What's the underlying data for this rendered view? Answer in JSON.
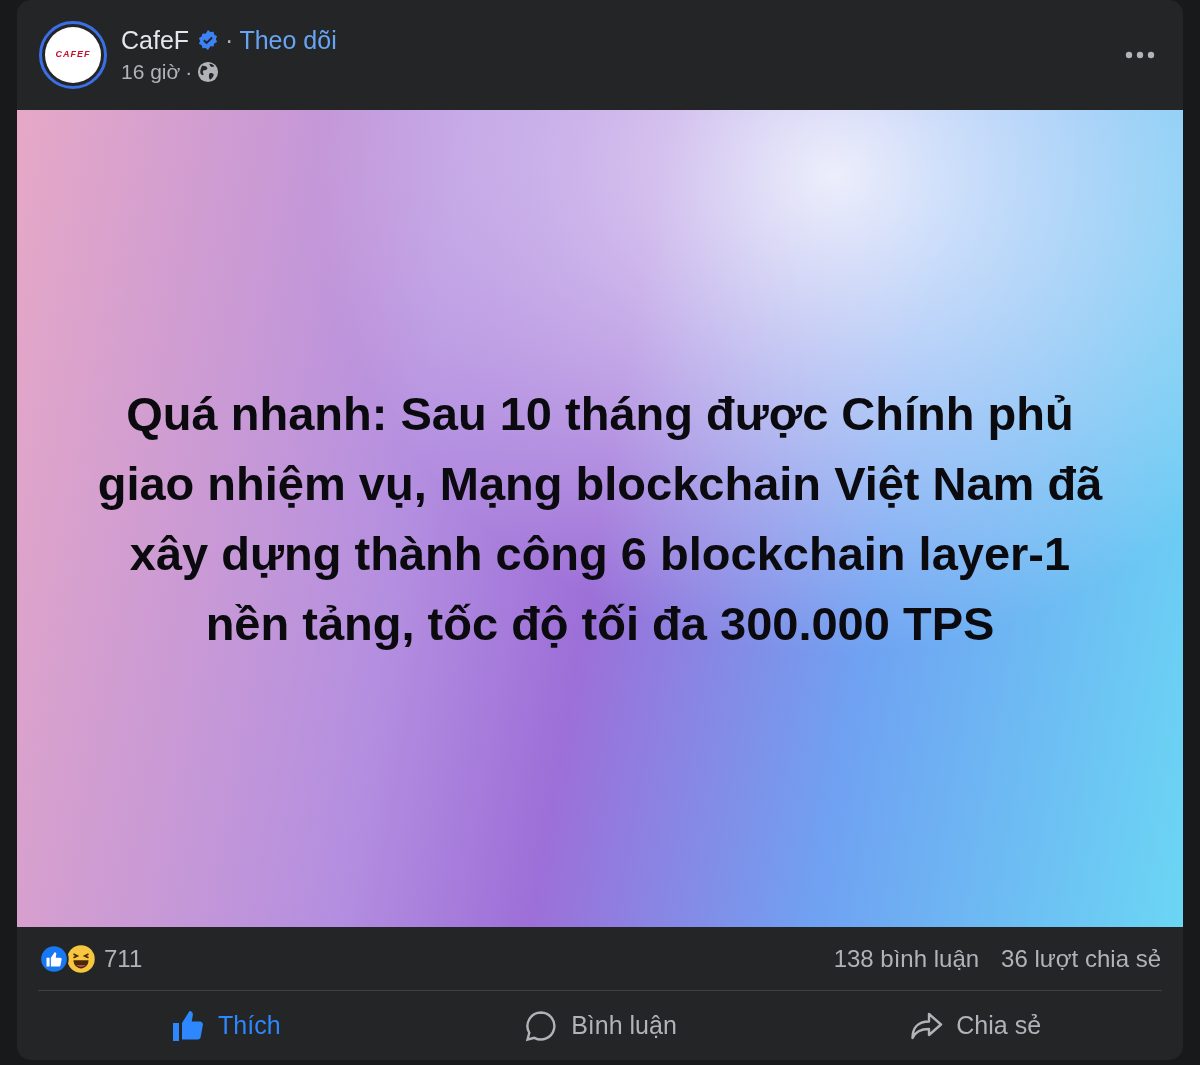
{
  "post": {
    "page_name": "CafeF",
    "logo_text": "CAFEF",
    "verified": true,
    "follow": "Theo dõi",
    "separator": "·",
    "time": "16 giờ",
    "time_separator": "·",
    "headline_lines": [
      "Quá nhanh: Sau 10 tháng được Chính phủ",
      "giao nhiệm vụ, Mạng blockchain Việt Nam đã",
      "xây dựng thành công 6 blockchain layer-1",
      "nền tảng, tốc độ tối đa 300.000 TPS"
    ],
    "reaction_count": "711",
    "comments": "138 bình luận",
    "shares": "36 lượt chia sẻ",
    "actions": [
      {
        "kind": "like",
        "label": "Thích",
        "selected": true
      },
      {
        "kind": "comment",
        "label": "Bình luận",
        "selected": false
      },
      {
        "kind": "share",
        "label": "Chia sẻ",
        "selected": false
      }
    ]
  }
}
